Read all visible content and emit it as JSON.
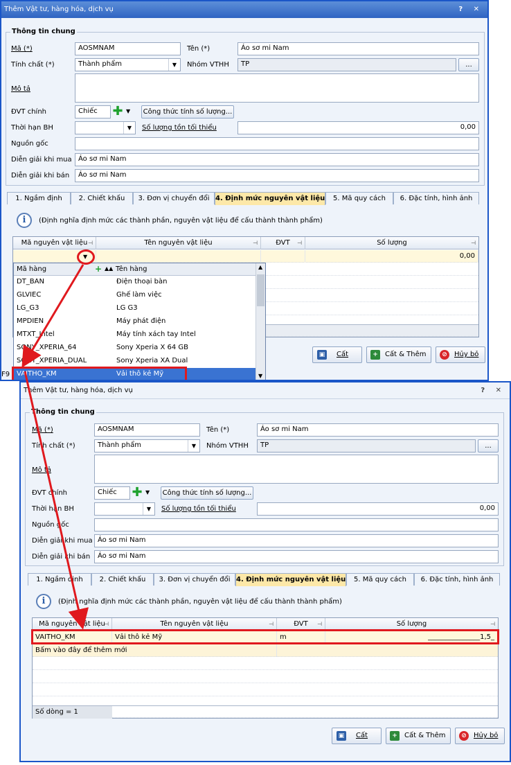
{
  "top": {
    "title": "Thêm Vật tư, hàng hóa, dịch vụ",
    "title_buttons": "? ✕",
    "general_group": "Thông tin chung",
    "labels": {
      "ma": "Mã (*)",
      "ten": "Tên (*)",
      "tinh_chat": "Tính chất (*)",
      "nhom": "Nhóm VTHH",
      "mo_ta": "Mô tả",
      "dvt": "ĐVT chính",
      "thoi_han": "Thời hạn BH",
      "sl_ton": "Số lượng tồn tối thiểu",
      "nguon_goc": "Nguồn gốc",
      "dg_mua": "Diễn giải khi mua",
      "dg_ban": "Diễn giải khi bán"
    },
    "values": {
      "ma": "AOSMNAM",
      "ten": "Áo sơ mi Nam",
      "tinh_chat": "Thành phẩm",
      "nhom": "TP",
      "dvt": "Chiếc",
      "sl_ton": "0,00",
      "dg_mua": "Áo sơ mi Nam",
      "dg_ban": "Áo sơ mi Nam"
    },
    "ellipsis": "...",
    "formula_button": "Công thức tính số lượng...",
    "tabs": [
      "1. Ngầm định",
      "2. Chiết khấu",
      "3. Đơn vị chuyển đổi",
      "4. Định mức nguyên vật liệu",
      "5. Mã quy cách",
      "6. Đặc tính, hình ảnh"
    ],
    "info_text": "(Định nghĩa định mức các thành phần, nguyên vật liệu để cấu thành thành phẩm)",
    "columns": [
      "Mã nguyên vật liệu",
      "Tên nguyên vật liệu",
      "ĐVT",
      "Số lượng"
    ],
    "row_qty": "0,00",
    "dropdown": {
      "headers": [
        "Mã hàng",
        "Tên hàng"
      ],
      "items": [
        {
          "code": "DT_BAN",
          "name": "Điện thoại bàn"
        },
        {
          "code": "GLVIEC",
          "name": "Ghế làm việc"
        },
        {
          "code": "LG_G3",
          "name": "LG G3"
        },
        {
          "code": "MPDIEN",
          "name": "Máy phát điện"
        },
        {
          "code": "MTXT_Intel",
          "name": "Máy tính xách tay Intel"
        },
        {
          "code": "SONY_XPERIA_64",
          "name": "Sony Xperia X 64 GB"
        },
        {
          "code": "SONY_XPERIA_DUAL",
          "name": "Sony Xperia XA Dual"
        },
        {
          "code": "VAITHO_KM",
          "name": "Vải thô kẻ Mỹ"
        }
      ]
    },
    "buttons": {
      "cat": "Cất",
      "cat_them": "Cất & Thêm",
      "huy": "Hủy bỏ"
    },
    "status_fragment": "F9"
  },
  "bottom": {
    "title": "Thêm Vật tư, hàng hóa, dịch vụ",
    "title_buttons": "? ✕",
    "general_group": "Thông tin chung",
    "labels": {
      "ma": "Mã (*)",
      "ten": "Tên (*)",
      "tinh_chat": "Tính chất (*)",
      "nhom": "Nhóm VTHH",
      "mo_ta": "Mô tả",
      "dvt": "ĐVT chính",
      "thoi_han": "Thời hạn BH",
      "sl_ton": "Số lượng tồn tối thiểu",
      "nguon_goc": "Nguồn gốc",
      "dg_mua": "Diễn giải khi mua",
      "dg_ban": "Diễn giải khi bán"
    },
    "values": {
      "ma": "AOSMNAM",
      "ten": "Áo sơ mi Nam",
      "tinh_chat": "Thành phẩm",
      "nhom": "TP",
      "dvt": "Chiếc",
      "sl_ton": "0,00",
      "dg_mua": "Áo sơ mi Nam",
      "dg_ban": "Áo sơ mi Nam"
    },
    "ellipsis": "...",
    "formula_button": "Công thức tính số lượng...",
    "tabs": [
      "1. Ngầm định",
      "2. Chiết khấu",
      "3. Đơn vị chuyển đổi",
      "4. Định mức nguyên vật liệu",
      "5. Mã quy cách",
      "6. Đặc tính, hình ảnh"
    ],
    "info_text": "(Định nghĩa định mức các thành phần, nguyên vật liệu để cấu thành thành phẩm)",
    "columns": [
      "Mã nguyên vật liệu",
      "Tên nguyên vật liệu",
      "ĐVT",
      "Số lượng"
    ],
    "row": {
      "code": "VAITHO_KM",
      "name": "Vải thô kẻ Mỹ",
      "unit": "m",
      "qty": "_______________1,5_"
    },
    "add_row_text": "Bấm vào đây để thêm mới",
    "row_count": "Số dòng = 1",
    "buttons": {
      "cat": "Cất",
      "cat_them": "Cất & Thêm",
      "huy": "Hủy bỏ"
    }
  },
  "colors": {
    "accent": "#1a56c8",
    "highlight": "#e0191e",
    "active_tab": "#fde8a8",
    "row_highlight": "#fff8dc"
  }
}
